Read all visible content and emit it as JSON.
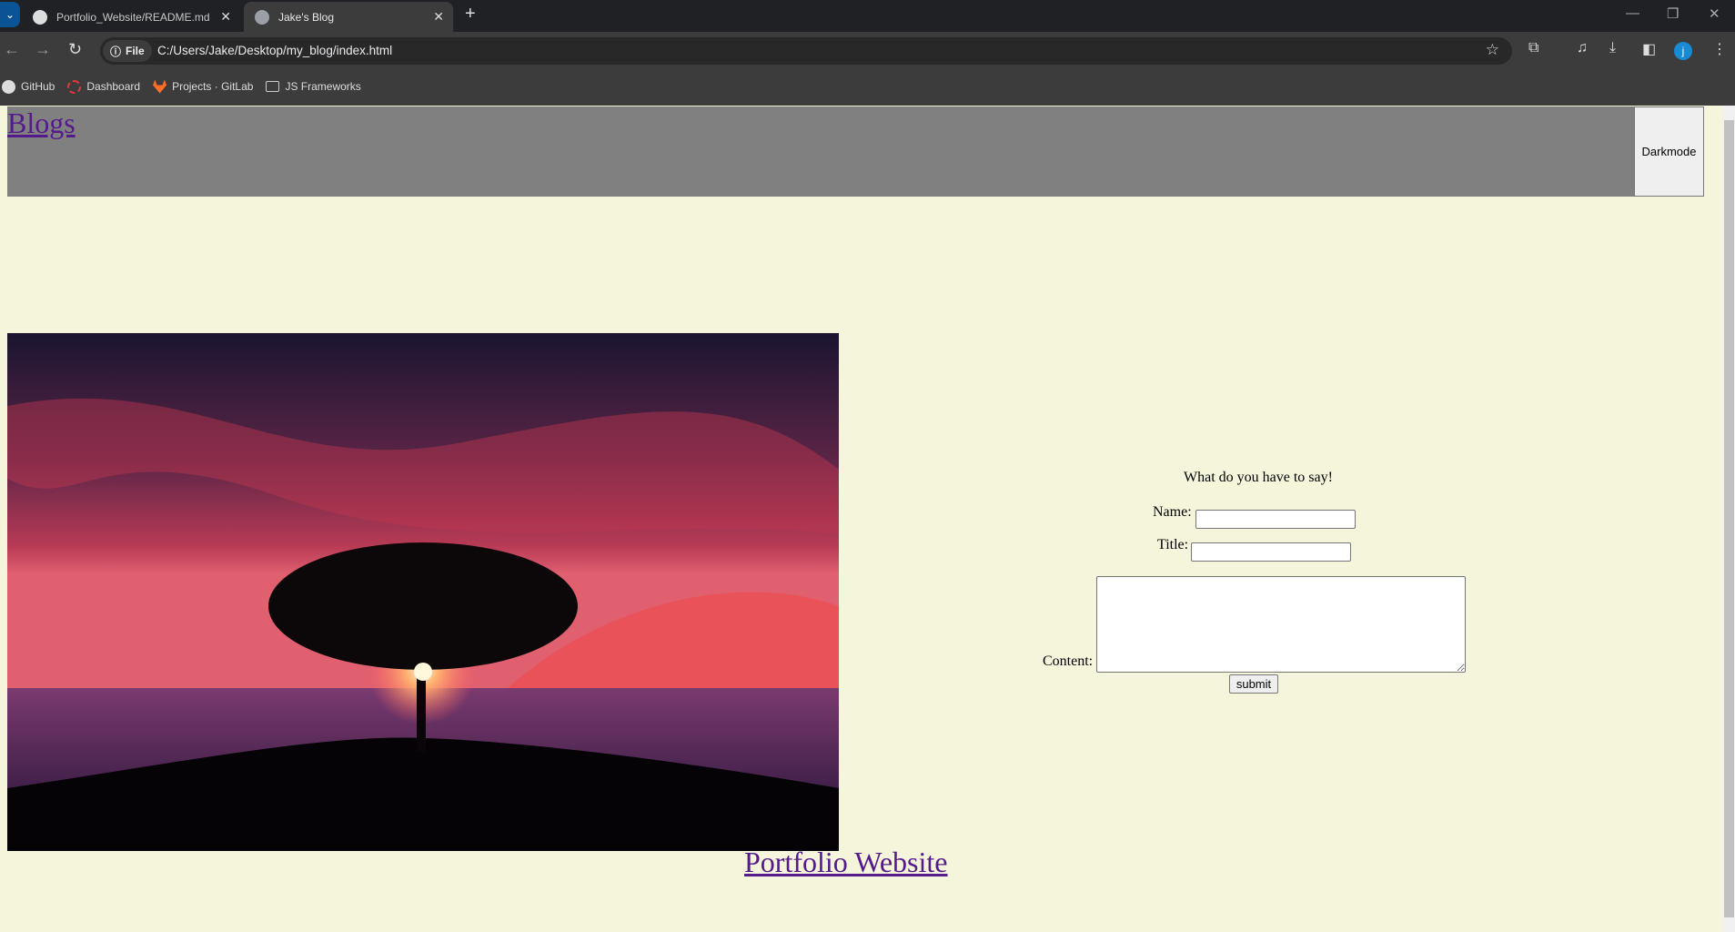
{
  "browser": {
    "tabs": [
      {
        "title": "Portfolio_Website/README.md",
        "icon": "github-icon",
        "active": false
      },
      {
        "title": "Jake's Blog",
        "icon": "globe-icon",
        "active": true
      }
    ],
    "address": {
      "chip_label": "File",
      "url": "C:/Users/Jake/Desktop/my_blog/index.html"
    },
    "profile_initial": "j",
    "bookmarks": [
      {
        "label": "GitHub",
        "icon": "github-icon"
      },
      {
        "label": "Dashboard",
        "icon": "dashboard-icon"
      },
      {
        "label": "Projects · GitLab",
        "icon": "gitlab-icon"
      },
      {
        "label": "JS Frameworks",
        "icon": "folder-icon"
      }
    ]
  },
  "page": {
    "header": {
      "blogs_link": "Blogs",
      "darkmode_button": "Darkmode"
    },
    "form": {
      "heading": "What do you have to say!",
      "name_label": "Name:",
      "name_value": "",
      "title_label": "Title:",
      "title_value": "",
      "content_label": "Content:",
      "content_value": "",
      "submit_label": "submit"
    },
    "footer_link": "Portfolio Website"
  },
  "colors": {
    "background": "#f5f5dc",
    "header": "#808080",
    "link": "#551a8b"
  }
}
